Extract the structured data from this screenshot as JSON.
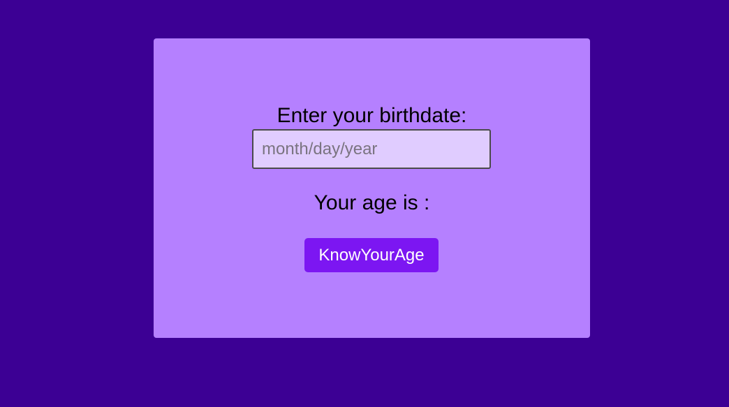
{
  "card": {
    "birthdate_label": "Enter your birthdate:",
    "birthdate_input": {
      "value": "",
      "placeholder": "month/day/year"
    },
    "age_label": "Your age is :",
    "submit_label": "KnowYourAge"
  },
  "colors": {
    "page_background": "#3c0094",
    "card_background": "#b580ff",
    "input_background": "#e0ccff",
    "button_background": "#7c16f2",
    "button_text": "#ffffff"
  }
}
